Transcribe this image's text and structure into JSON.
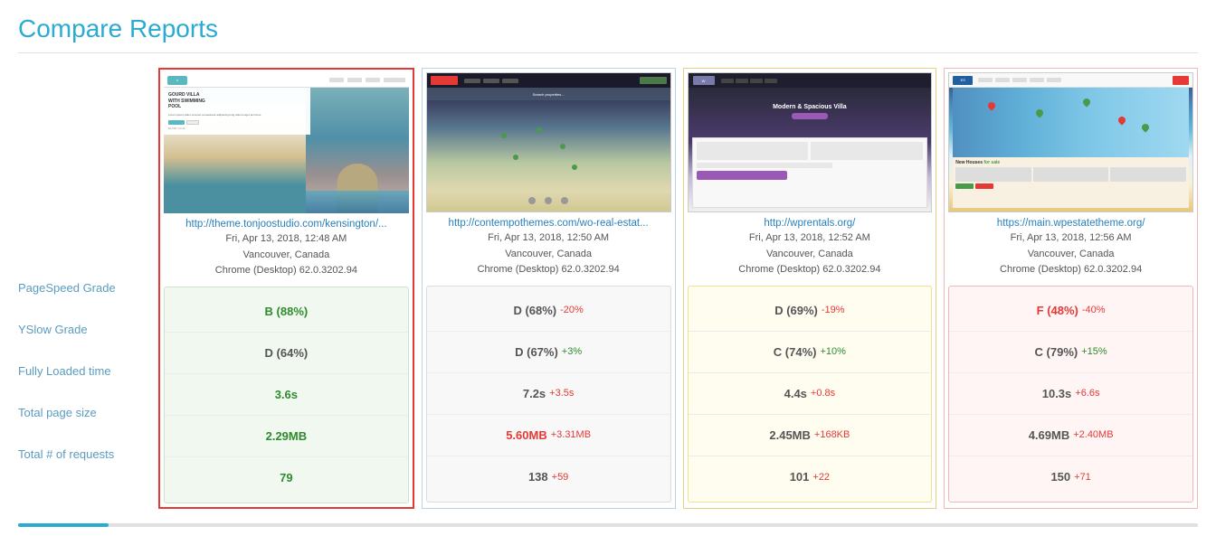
{
  "page": {
    "title": "Compare Reports"
  },
  "labels": {
    "pagespeed": "PageSpeed Grade",
    "yslow": "YSlow Grade",
    "loaded": "Fully Loaded time",
    "size": "Total page size",
    "requests": "Total # of requests"
  },
  "reports": [
    {
      "id": "report-1",
      "selected": true,
      "border_style": "selected",
      "url_display": "http://theme.tonjoostudio.com/kensington/...",
      "url_full": "http://theme.tonjoostudio.com/kensington/",
      "date": "Fri, Apr 13, 2018, 12:48 AM",
      "location": "Vancouver, Canada",
      "browser": "Chrome (Desktop) 62.0.3202.94",
      "metrics": {
        "pagespeed": {
          "value": "B (88%)",
          "delta": "",
          "value_color": "green"
        },
        "yslow": {
          "value": "D (64%)",
          "delta": "",
          "value_color": "gray"
        },
        "loaded": {
          "value": "3.6s",
          "delta": "",
          "value_color": "green"
        },
        "size": {
          "value": "2.29MB",
          "delta": "",
          "value_color": "green"
        },
        "requests": {
          "value": "79",
          "delta": "",
          "value_color": "green"
        }
      }
    },
    {
      "id": "report-2",
      "selected": false,
      "border_style": "blue",
      "url_display": "http://contempothemes.com/wo-real-estat...",
      "url_full": "http://contempothemes.com/wo-real-estat...",
      "date": "Fri, Apr 13, 2018, 12:50 AM",
      "location": "Vancouver, Canada",
      "browser": "Chrome (Desktop) 62.0.3202.94",
      "metrics": {
        "pagespeed": {
          "value": "D (68%)",
          "delta": "-20%",
          "value_color": "gray",
          "delta_type": "neg"
        },
        "yslow": {
          "value": "D (67%)",
          "delta": "+3%",
          "value_color": "gray",
          "delta_type": "pos"
        },
        "loaded": {
          "value": "7.2s",
          "delta": "+3.5s",
          "value_color": "gray",
          "delta_type": "neg"
        },
        "size": {
          "value": "5.60MB",
          "delta": "+3.31MB",
          "value_color": "red",
          "delta_type": "neg"
        },
        "requests": {
          "value": "138",
          "delta": "+59",
          "value_color": "gray",
          "delta_type": "neg"
        }
      }
    },
    {
      "id": "report-3",
      "selected": false,
      "border_style": "yellow",
      "url_display": "http://wprentals.org/",
      "url_full": "http://wprentals.org/",
      "date": "Fri, Apr 13, 2018, 12:52 AM",
      "location": "Vancouver, Canada",
      "browser": "Chrome (Desktop) 62.0.3202.94",
      "metrics": {
        "pagespeed": {
          "value": "D (69%)",
          "delta": "-19%",
          "value_color": "gray",
          "delta_type": "neg"
        },
        "yslow": {
          "value": "C (74%)",
          "delta": "+10%",
          "value_color": "gray",
          "delta_type": "pos"
        },
        "loaded": {
          "value": "4.4s",
          "delta": "+0.8s",
          "value_color": "gray",
          "delta_type": "neg"
        },
        "size": {
          "value": "2.45MB",
          "delta": "+168KB",
          "value_color": "gray",
          "delta_type": "neg"
        },
        "requests": {
          "value": "101",
          "delta": "+22",
          "value_color": "gray",
          "delta_type": "neg"
        }
      }
    },
    {
      "id": "report-4",
      "selected": false,
      "border_style": "red",
      "url_display": "https://main.wpestatetheme.org/",
      "url_full": "https://main.wpestatetheme.org/",
      "date": "Fri, Apr 13, 2018, 12:56 AM",
      "location": "Vancouver, Canada",
      "browser": "Chrome (Desktop) 62.0.3202.94",
      "metrics": {
        "pagespeed": {
          "value": "F (48%)",
          "delta": "-40%",
          "value_color": "red",
          "delta_type": "neg"
        },
        "yslow": {
          "value": "C (79%)",
          "delta": "+15%",
          "value_color": "gray",
          "delta_type": "pos"
        },
        "loaded": {
          "value": "10.3s",
          "delta": "+6.6s",
          "value_color": "gray",
          "delta_type": "neg"
        },
        "size": {
          "value": "4.69MB",
          "delta": "+2.40MB",
          "value_color": "gray",
          "delta_type": "neg"
        },
        "requests": {
          "value": "150",
          "delta": "+71",
          "value_color": "gray",
          "delta_type": "neg"
        }
      }
    }
  ]
}
